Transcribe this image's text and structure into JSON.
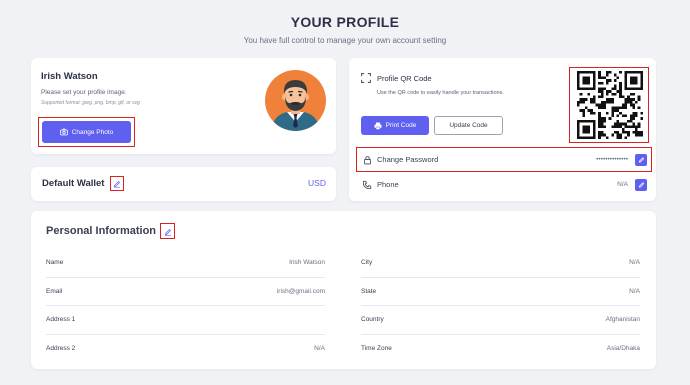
{
  "page": {
    "title": "YOUR PROFILE",
    "subtitle": "You have full control to manage your own account setting"
  },
  "profile": {
    "name": "Irish Watson",
    "hint": "Please set your profile image.",
    "formats": "Supported format: jpeg, png, bmp, gif, or svg",
    "change_photo_label": "Change Photo"
  },
  "wallet": {
    "label": "Default Wallet",
    "value": "USD"
  },
  "qr": {
    "title": "Profile QR Code",
    "description": "Use the QR code to easily handle your transactions.",
    "print_label": "Print Code",
    "update_label": "Update Code"
  },
  "security": {
    "password_label": "Change Password",
    "password_value": "••••••••••••••",
    "phone_label": "Phone",
    "phone_value": "N/A"
  },
  "personal": {
    "title": "Personal Information",
    "left": [
      {
        "label": "Name",
        "value": "Irish Watson"
      },
      {
        "label": "Email",
        "value": "irish@gmail.com"
      },
      {
        "label": "Address 1",
        "value": ""
      },
      {
        "label": "Address 2",
        "value": "N/A"
      }
    ],
    "right": [
      {
        "label": "City",
        "value": "N/A"
      },
      {
        "label": "State",
        "value": "N/A"
      },
      {
        "label": "Country",
        "value": "Afghanistan"
      },
      {
        "label": "Time Zone",
        "value": "Asia/Dhaka"
      }
    ]
  },
  "colors": {
    "accent": "#5f5ff0",
    "highlight": "#d92323",
    "avatar_bg": "#f0813a",
    "background": "#f1f2f6"
  },
  "icons": {
    "photo": "camera-icon",
    "edit": "pencil-icon",
    "qr": "scan-icon",
    "print": "printer-icon",
    "password": "lock-icon",
    "phone": "phone-icon"
  }
}
